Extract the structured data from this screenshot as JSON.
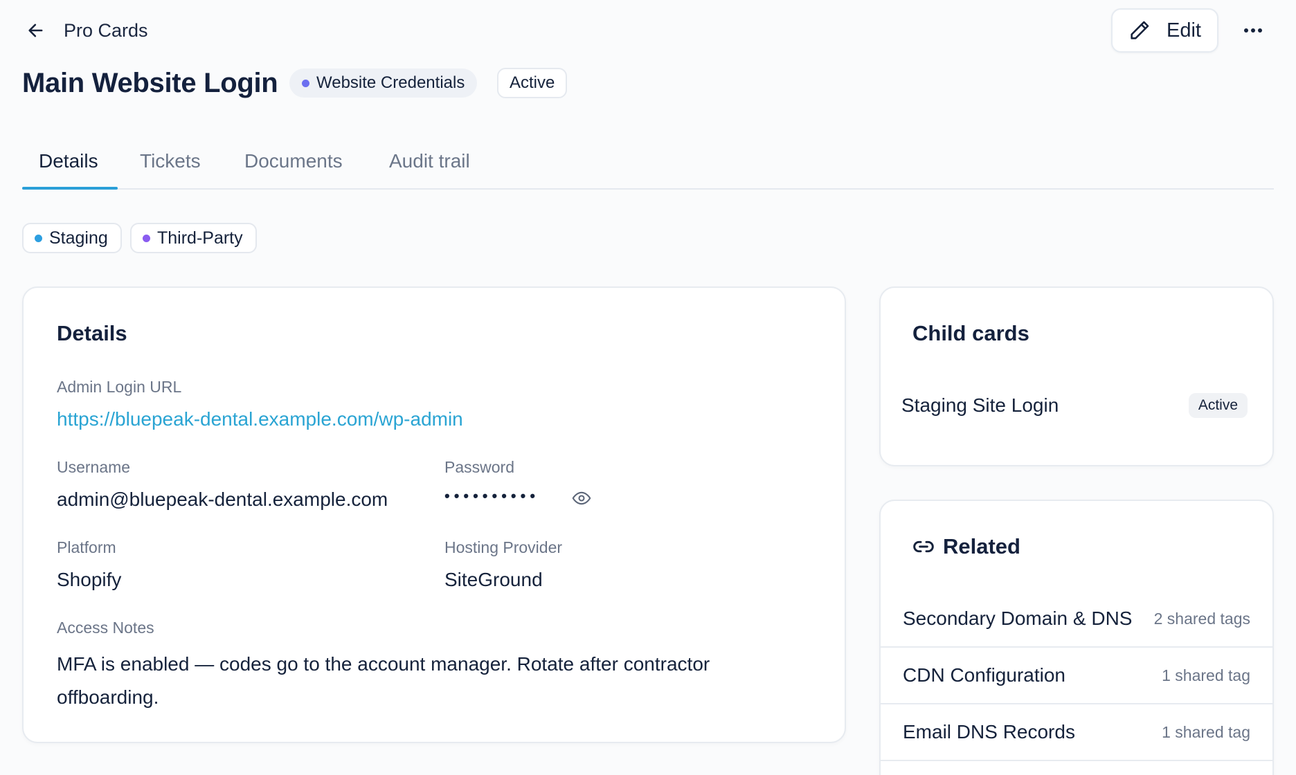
{
  "header": {
    "breadcrumb": "Pro Cards",
    "edit_label": "Edit",
    "title": "Main Website Login",
    "category": {
      "label": "Website Credentials",
      "dot_color": "#6b6ff0"
    },
    "status": "Active"
  },
  "tabs": [
    {
      "label": "Details",
      "active": true
    },
    {
      "label": "Tickets",
      "active": false
    },
    {
      "label": "Documents",
      "active": false
    },
    {
      "label": "Audit trail",
      "active": false
    }
  ],
  "tags": [
    {
      "label": "Staging",
      "dot_color": "#2d9fe0"
    },
    {
      "label": "Third-Party",
      "dot_color": "#8a5cf0"
    }
  ],
  "details": {
    "title": "Details",
    "admin_url_label": "Admin Login URL",
    "admin_url": "https://bluepeak-dental.example.com/wp-admin",
    "username_label": "Username",
    "username": "admin@bluepeak-dental.example.com",
    "password_label": "Password",
    "password_masked": "••••••••••",
    "platform_label": "Platform",
    "platform": "Shopify",
    "hosting_label": "Hosting Provider",
    "hosting": "SiteGround",
    "notes_label": "Access Notes",
    "notes": "MFA is enabled — codes go to the account manager. Rotate after contractor offboarding."
  },
  "child_cards": {
    "title": "Child cards",
    "items": [
      {
        "name": "Staging Site Login",
        "status": "Active"
      }
    ]
  },
  "related": {
    "title": "Related",
    "items": [
      {
        "name": "Secondary Domain & DNS",
        "meta": "2 shared tags"
      },
      {
        "name": "CDN Configuration",
        "meta": "1 shared tag"
      },
      {
        "name": "Email DNS Records",
        "meta": "1 shared tag"
      }
    ]
  },
  "icons": [
    "arrow-left-icon",
    "pencil-icon",
    "more-horizontal-icon",
    "eye-icon",
    "link-icon"
  ]
}
